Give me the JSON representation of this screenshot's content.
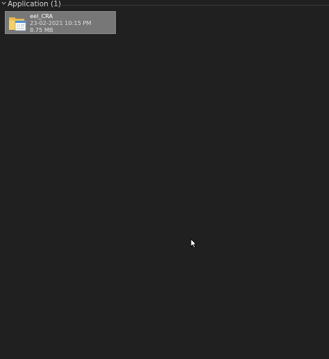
{
  "group": {
    "title": "Application (1)"
  },
  "items": [
    {
      "name": "eel_CRA",
      "modified": "23-02-2021 10:15 PM",
      "size": "8.75 MB",
      "icon": "application-icon"
    }
  ],
  "colors": {
    "background": "#202020",
    "tile_selected": "#777777",
    "text": "#d6d6d6"
  }
}
